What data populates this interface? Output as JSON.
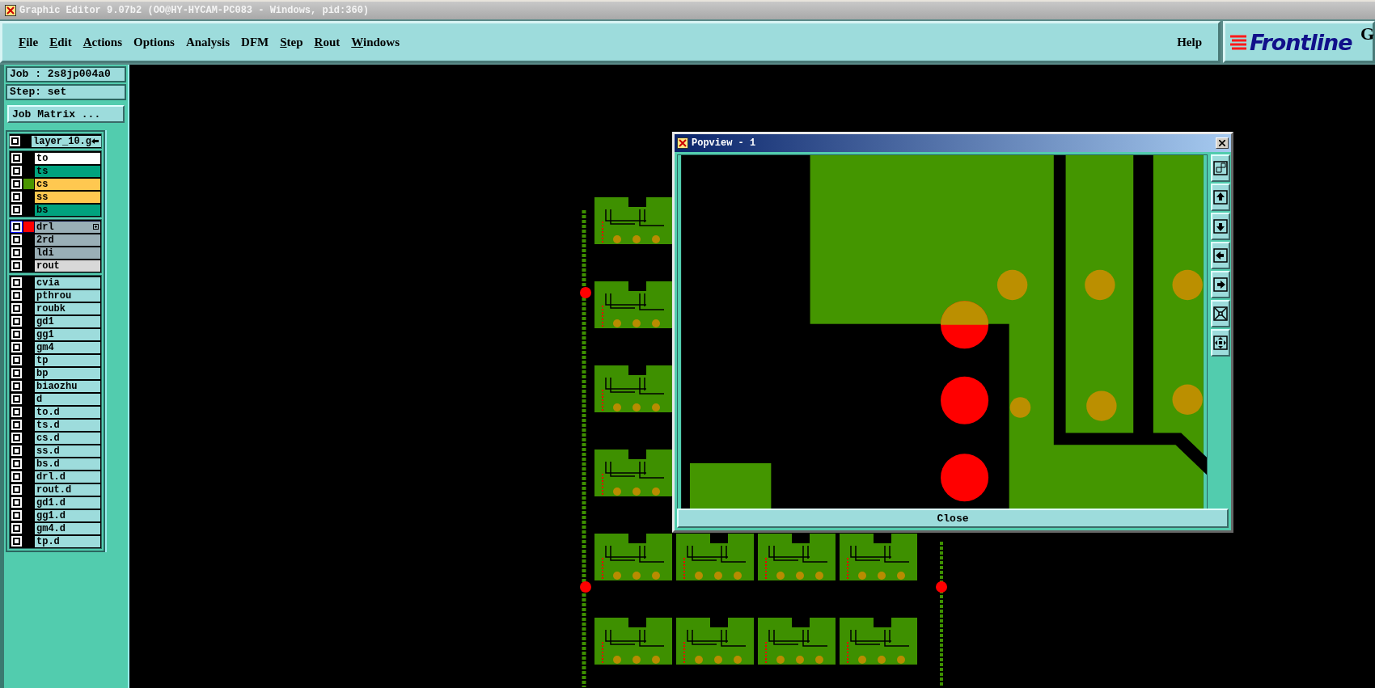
{
  "window": {
    "title": "Graphic Editor 9.07b2 (OO@HY-HYCAM-PC083 - Windows, pid:360)"
  },
  "menu": {
    "items": [
      {
        "label": "File",
        "underlined": true
      },
      {
        "label": "Edit",
        "underlined": true
      },
      {
        "label": "Actions",
        "underlined": true
      },
      {
        "label": "Options",
        "underlined": false
      },
      {
        "label": "Analysis",
        "underlined": false
      },
      {
        "label": "DFM",
        "underlined": false
      },
      {
        "label": "Step",
        "underlined": true
      },
      {
        "label": "Rout",
        "underlined": true
      },
      {
        "label": "Windows",
        "underlined": true
      }
    ],
    "help": "Help"
  },
  "logo": {
    "text": "Frontline",
    "superscript": "G"
  },
  "job_panel": {
    "job": "Job : 2s8jp004a0",
    "step": "Step: set",
    "job_matrix_button": "Job Matrix ..."
  },
  "layer_groups": [
    {
      "layers": [
        {
          "name": "layer_10.g",
          "kind": "work",
          "selected": false
        }
      ]
    },
    {
      "layers": [
        {
          "name": "to",
          "kind": "silk_screen",
          "selected": false
        },
        {
          "name": "ts",
          "kind": "solder_mask",
          "selected": false
        },
        {
          "name": "cs",
          "kind": "signal",
          "selected": false,
          "color": "#4a9600"
        },
        {
          "name": "ss",
          "kind": "signal",
          "selected": false
        },
        {
          "name": "bs",
          "kind": "solder_mask",
          "selected": false
        }
      ]
    },
    {
      "layers": [
        {
          "name": "drl",
          "kind": "drill",
          "selected": true,
          "color": "#ff0000",
          "sublayers": true
        },
        {
          "name": "2rd",
          "kind": "drill",
          "selected": false
        },
        {
          "name": "ldi",
          "kind": "drill",
          "selected": false
        },
        {
          "name": "rout",
          "kind": "rout",
          "selected": false
        }
      ]
    },
    {
      "layers": [
        {
          "name": "cvia",
          "kind": "misc",
          "selected": false
        },
        {
          "name": "pthrou",
          "kind": "misc",
          "selected": false
        },
        {
          "name": "roubk",
          "kind": "misc",
          "selected": false
        },
        {
          "name": "gd1",
          "kind": "misc",
          "selected": false
        },
        {
          "name": "gg1",
          "kind": "misc",
          "selected": false
        },
        {
          "name": "gm4",
          "kind": "misc",
          "selected": false
        },
        {
          "name": "tp",
          "kind": "misc",
          "selected": false
        },
        {
          "name": "bp",
          "kind": "misc",
          "selected": false
        },
        {
          "name": "biaozhu",
          "kind": "misc",
          "selected": false
        },
        {
          "name": "d",
          "kind": "misc",
          "selected": false
        },
        {
          "name": "to.d",
          "kind": "misc",
          "selected": false
        },
        {
          "name": "ts.d",
          "kind": "misc",
          "selected": false
        },
        {
          "name": "cs.d",
          "kind": "misc",
          "selected": false
        },
        {
          "name": "ss.d",
          "kind": "misc",
          "selected": false
        },
        {
          "name": "bs.d",
          "kind": "misc",
          "selected": false
        },
        {
          "name": "drl.d",
          "kind": "misc",
          "selected": false
        },
        {
          "name": "rout.d",
          "kind": "misc",
          "selected": false
        },
        {
          "name": "gd1.d",
          "kind": "misc",
          "selected": false
        },
        {
          "name": "gg1.d",
          "kind": "misc",
          "selected": false
        },
        {
          "name": "gm4.d",
          "kind": "misc",
          "selected": false
        },
        {
          "name": "tp.d",
          "kind": "misc",
          "selected": false
        }
      ]
    }
  ],
  "popview": {
    "title": "Popview - 1",
    "close_button": "Close"
  }
}
